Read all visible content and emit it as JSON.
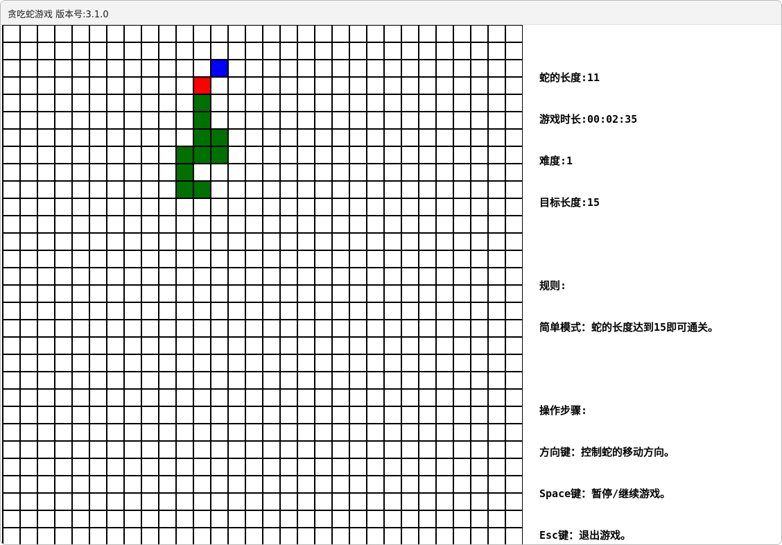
{
  "window": {
    "title": "贪吃蛇游戏 版本号:3.1.0"
  },
  "board": {
    "cols": 30,
    "rows": 30,
    "colors": {
      "snake_body": "#007000",
      "snake_head": "#ff0000",
      "food": "#0000ff",
      "grid_line": "#000000",
      "background": "#ffffff"
    },
    "food": {
      "col": 12,
      "row": 2
    },
    "snake_head": {
      "col": 11,
      "row": 3
    },
    "snake_body": [
      {
        "col": 11,
        "row": 4
      },
      {
        "col": 11,
        "row": 5
      },
      {
        "col": 11,
        "row": 6
      },
      {
        "col": 12,
        "row": 6
      },
      {
        "col": 12,
        "row": 7
      },
      {
        "col": 11,
        "row": 7
      },
      {
        "col": 10,
        "row": 7
      },
      {
        "col": 10,
        "row": 8
      },
      {
        "col": 10,
        "row": 9
      },
      {
        "col": 11,
        "row": 9
      }
    ]
  },
  "info": {
    "snake_length": "蛇的长度:11",
    "game_time": "游戏时长:00:02:35",
    "difficulty": "难度:1",
    "target_length": "目标长度:15",
    "rules_heading": "规则:",
    "rules_text": "简单模式：蛇的长度达到15即可通关。",
    "steps_heading": "操作步骤:",
    "step_arrows": "方向键：控制蛇的移动方向。",
    "step_space": "Space键：暂停/继续游戏。",
    "step_esc": "Esc键：退出游戏。"
  }
}
